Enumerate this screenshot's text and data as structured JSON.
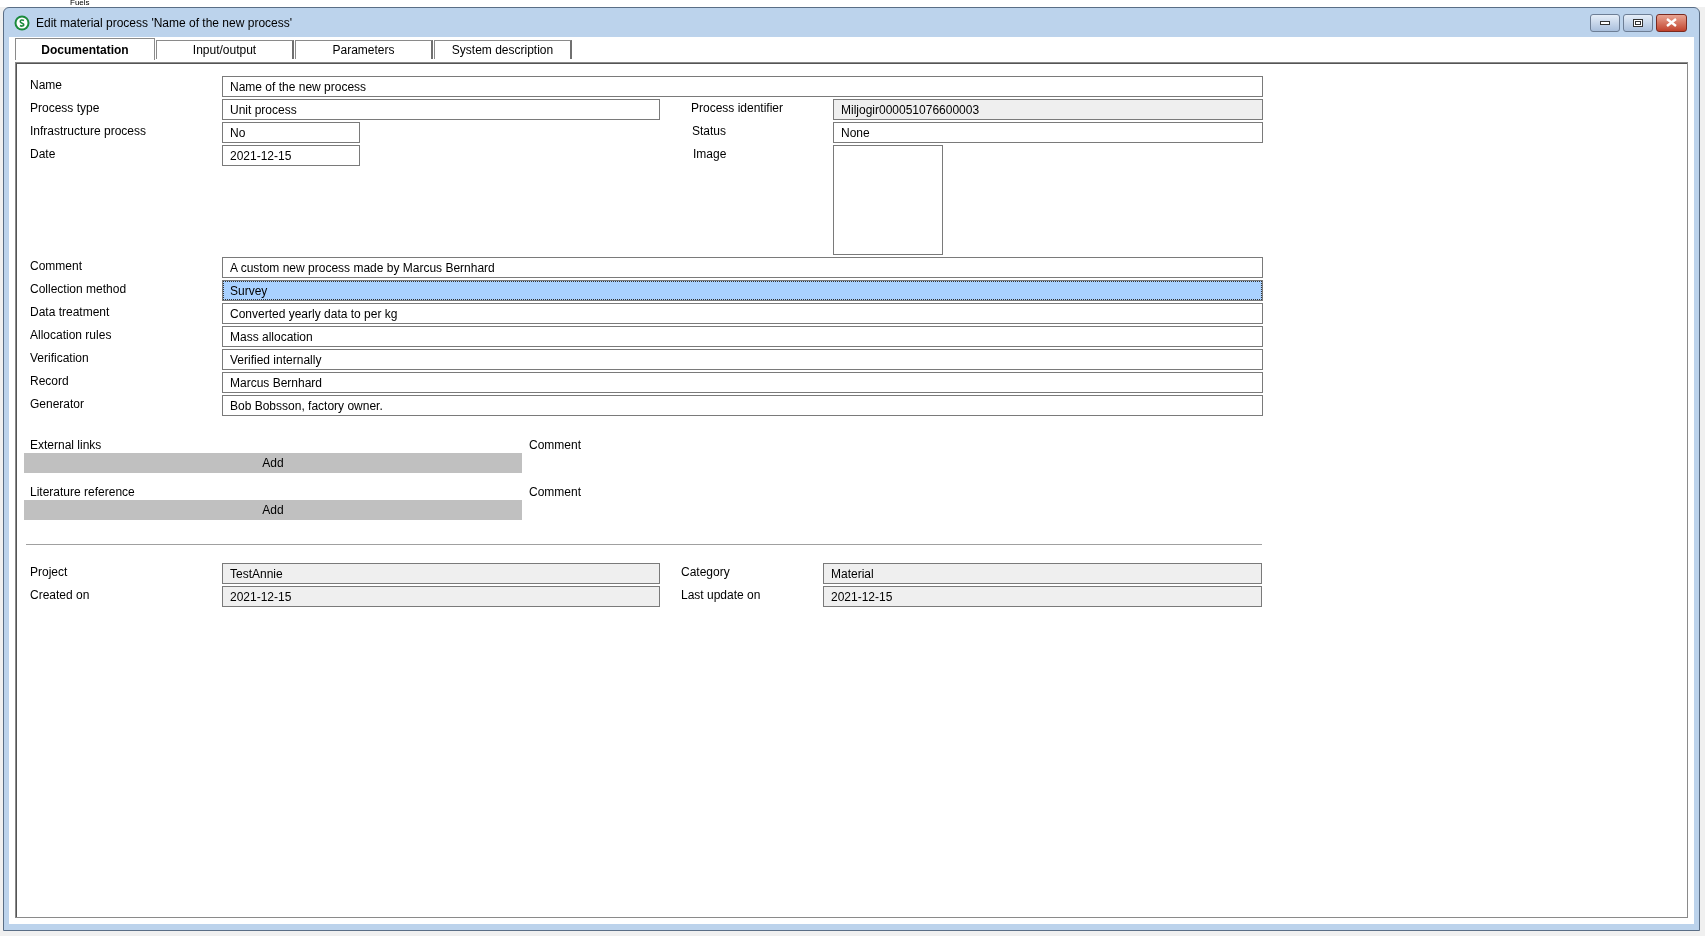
{
  "background": {
    "tree_item": "Fuels"
  },
  "window": {
    "title": "Edit material process 'Name of the new process'"
  },
  "tabs": [
    {
      "label": "Documentation",
      "selected": true
    },
    {
      "label": "Input/output",
      "selected": false
    },
    {
      "label": "Parameters",
      "selected": false
    },
    {
      "label": "System description",
      "selected": false
    }
  ],
  "general": {
    "name": {
      "label": "Name",
      "value": "Name of the new process"
    },
    "process_type": {
      "label": "Process type",
      "value": "Unit process"
    },
    "infrastructure_process": {
      "label": "Infrastructure process",
      "value": "No"
    },
    "date": {
      "label": "Date",
      "value": "2021-12-15"
    },
    "process_identifier": {
      "label": "Process identifier",
      "value": "Miljogir000051076600003",
      "read_only": true
    },
    "status": {
      "label": "Status",
      "value": "None",
      "read_only": false
    },
    "image": {
      "label": "Image"
    }
  },
  "details": [
    {
      "label": "Comment",
      "value": "A custom new process made by Marcus Bernhard",
      "focused": false
    },
    {
      "label": "Collection method",
      "value": "Survey",
      "focused": true
    },
    {
      "label": "Data treatment",
      "value": "Converted yearly data to per kg",
      "focused": false
    },
    {
      "label": "Allocation rules",
      "value": "Mass allocation",
      "focused": false
    },
    {
      "label": "Verification",
      "value": "Verified internally",
      "focused": false
    },
    {
      "label": "Record",
      "value": "Marcus Bernhard",
      "focused": false
    },
    {
      "label": "Generator",
      "value": "Bob Bobsson, factory owner.",
      "focused": false
    }
  ],
  "references": [
    {
      "label": "External links",
      "button": "Add",
      "comment_label": "Comment"
    },
    {
      "label": "Literature reference",
      "button": "Add",
      "comment_label": "Comment"
    }
  ],
  "footer": [
    {
      "label": "Project",
      "value": "TestAnnie",
      "read_only": true
    },
    {
      "label": "Category",
      "value": "Material",
      "read_only": true
    },
    {
      "label": "Created on",
      "value": "2021-12-15",
      "read_only": true
    },
    {
      "label": "Last update on",
      "value": "2021-12-15",
      "read_only": true
    }
  ]
}
